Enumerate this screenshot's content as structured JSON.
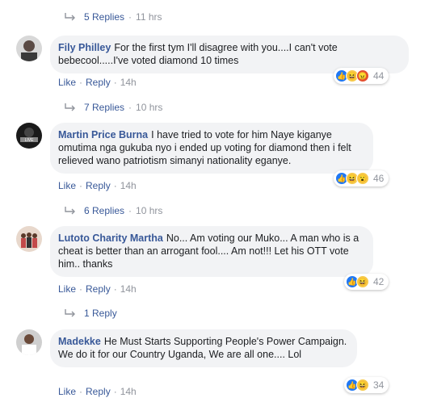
{
  "threads": [
    {
      "replies_link": "5 Replies",
      "replies_time": "11 hrs"
    },
    {
      "author": "Fily Philley",
      "text": "For the first tym I'll disagree with you....I can't vote bebecool.....I've voted diamond 10 times",
      "like": "Like",
      "reply": "Reply",
      "time": "14h",
      "reaction_count": "44",
      "reaction_icons": [
        "like-icon",
        "haha-icon",
        "angry-icon"
      ]
    },
    {
      "replies_link": "7 Replies",
      "replies_time": "10 hrs"
    },
    {
      "author": "Martin Price Burna",
      "text": "I have tried to vote for him Naye kiganye omutima nga gukuba nyo i ended up voting for diamond then i felt relieved wano patriotism simanyi nationality eganye.",
      "like": "Like",
      "reply": "Reply",
      "time": "14h",
      "reaction_count": "46",
      "reaction_icons": [
        "like-icon",
        "haha-icon",
        "wow-icon"
      ]
    },
    {
      "replies_link": "6 Replies",
      "replies_time": "10 hrs"
    },
    {
      "author": "Lutoto Charity Martha",
      "text": "No... Am voting our Muko... A man who is a cheat is better than an arrogant fool.... Am not!!! Let his OTT vote him.. thanks",
      "like": "Like",
      "reply": "Reply",
      "time": "14h",
      "reaction_count": "42",
      "reaction_icons": [
        "like-icon",
        "haha-icon"
      ]
    },
    {
      "replies_link": "1 Reply",
      "replies_time": ""
    },
    {
      "author": "Madekke",
      "text": "He Must Starts Supporting People's Power Campaign. We do it for our Country Uganda, We are all one.... Lol",
      "like": "Like",
      "reply": "Reply",
      "time": "14h",
      "reaction_count": "34",
      "reaction_icons": [
        "like-icon",
        "haha-icon"
      ]
    }
  ],
  "colors": {
    "link": "#385898",
    "meta": "#90949c",
    "bubble": "#f2f3f5",
    "like_blue": "#2078f4"
  }
}
